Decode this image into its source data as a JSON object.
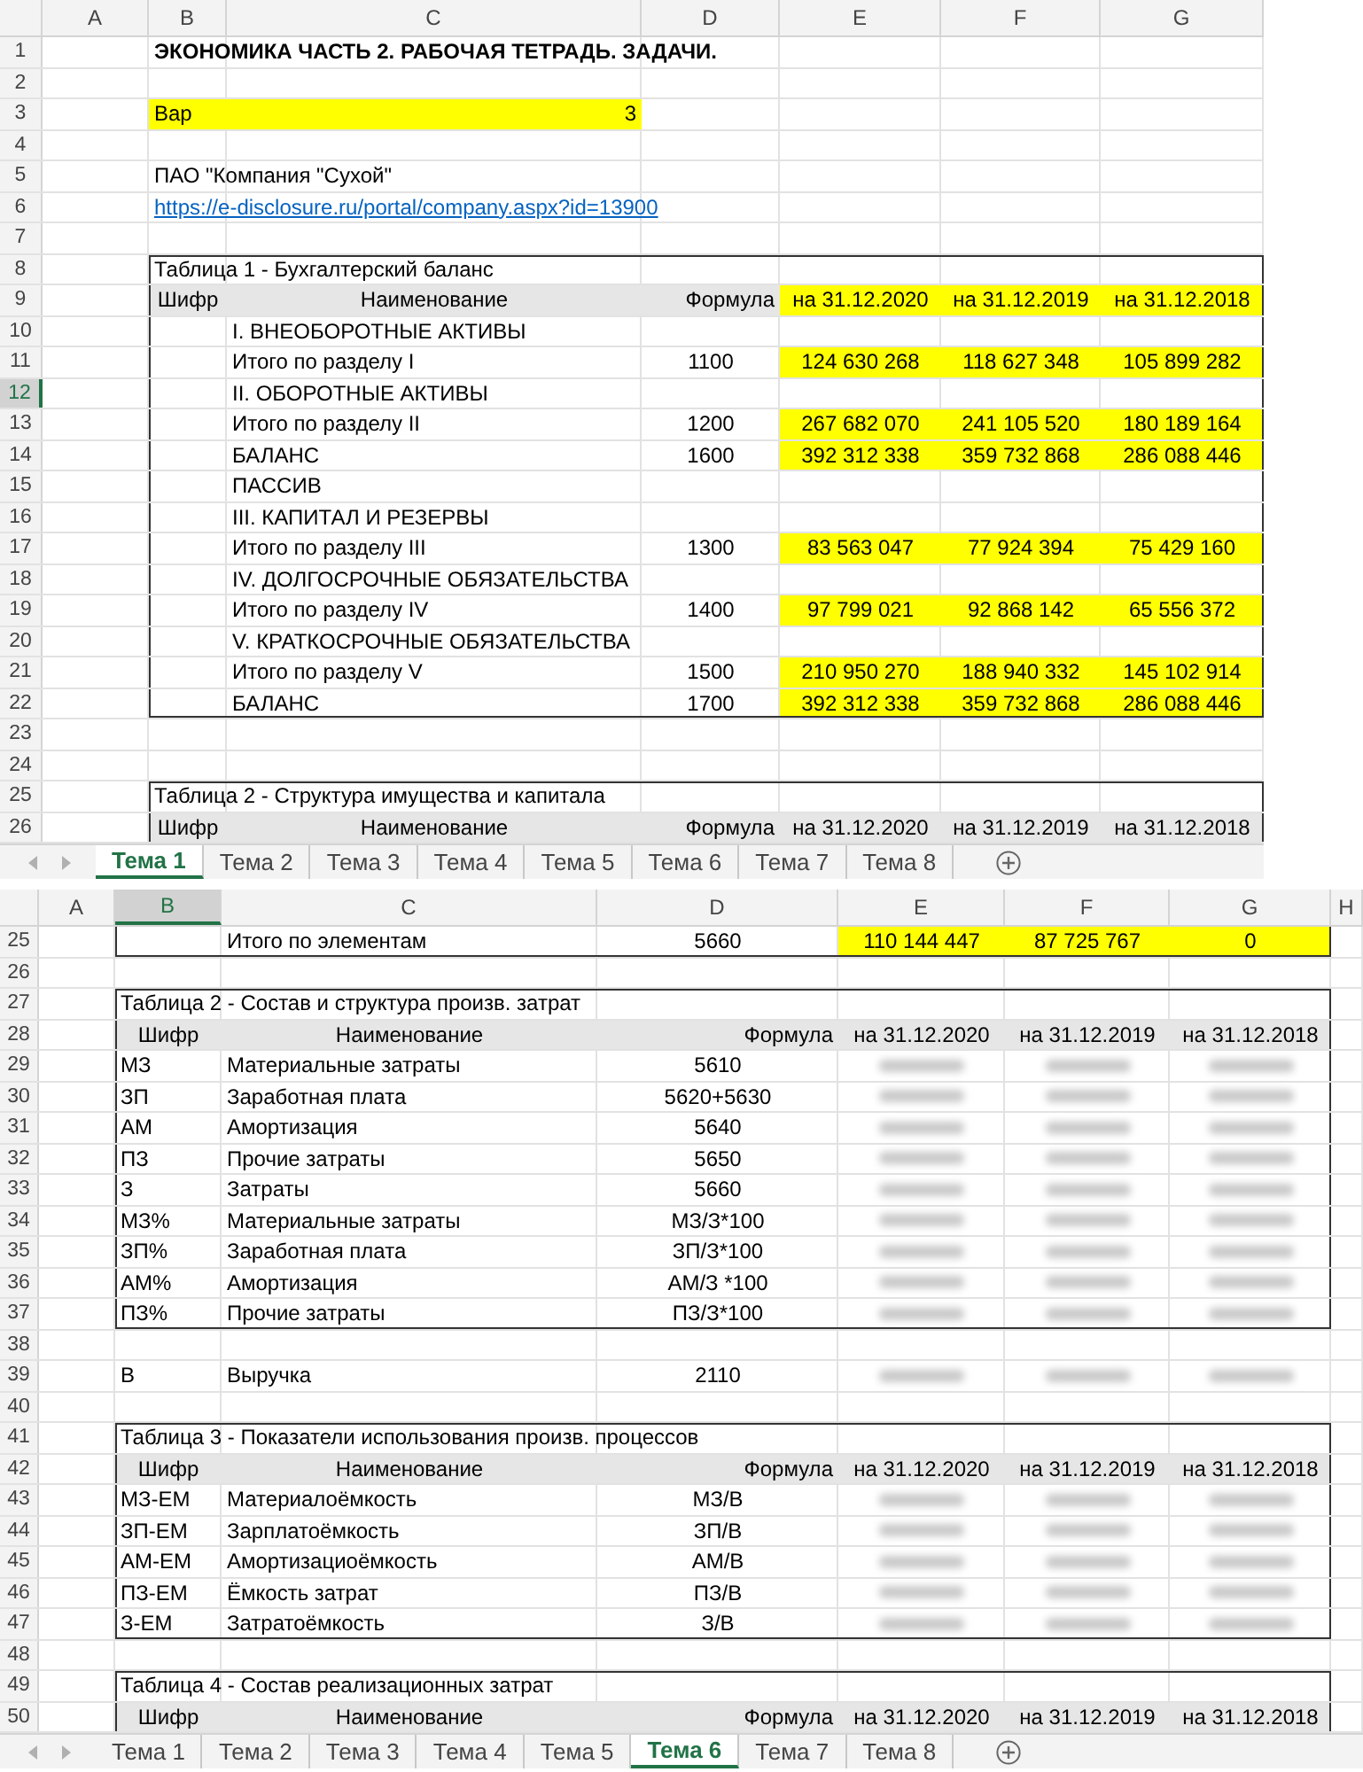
{
  "sheets": [
    {
      "columns": [
        {
          "label": "A",
          "selected": false
        },
        {
          "label": "B",
          "selected": false
        },
        {
          "label": "C",
          "selected": false
        },
        {
          "label": "D",
          "selected": false
        },
        {
          "label": "E",
          "selected": false
        },
        {
          "label": "F",
          "selected": false
        },
        {
          "label": "G",
          "selected": false
        }
      ],
      "rows": [
        {
          "num": "1",
          "selected": false,
          "kind": "title",
          "text": "ЭКОНОМИКА ЧАСТЬ 2. РАБОЧАЯ ТЕТРАДЬ. ЗАДАЧИ."
        },
        {
          "num": "2",
          "selected": false,
          "kind": "blank"
        },
        {
          "num": "3",
          "selected": false,
          "kind": "var",
          "label": "Вар",
          "value": "3"
        },
        {
          "num": "4",
          "selected": false,
          "kind": "blank"
        },
        {
          "num": "5",
          "selected": false,
          "kind": "text",
          "text": "ПАО \"Компания \"Сухой\""
        },
        {
          "num": "6",
          "selected": false,
          "kind": "link",
          "text": "https://e-disclosure.ru/portal/company.aspx?id=13900"
        },
        {
          "num": "7",
          "selected": false,
          "kind": "blank"
        },
        {
          "num": "8",
          "selected": false,
          "kind": "caption",
          "text": "Таблица 1 - Бухгалтерский баланс",
          "boxed": true
        },
        {
          "num": "9",
          "selected": false,
          "kind": "header",
          "code": "Шифр",
          "name": "Наименование",
          "formula": "Формула",
          "dates": [
            "на 31.12.2020",
            "на 31.12.2019",
            "на 31.12.2018"
          ],
          "highlighted": true,
          "boxed": true
        },
        {
          "num": "10",
          "selected": false,
          "kind": "section",
          "text": "I. ВНЕОБОРОТНЫЕ АКТИВЫ",
          "boxed": true
        },
        {
          "num": "11",
          "selected": false,
          "kind": "data",
          "name": "Итого по разделу I",
          "formula": "1100",
          "values": [
            "124 630 268",
            "118 627 348",
            "105 899 282"
          ],
          "highlighted": true,
          "values_hidden": false,
          "boxed": true
        },
        {
          "num": "12",
          "selected": true,
          "kind": "section",
          "text": "II. ОБОРОТНЫЕ АКТИВЫ",
          "boxed": true
        },
        {
          "num": "13",
          "selected": false,
          "kind": "data",
          "name": "Итого по разделу II",
          "formula": "1200",
          "values": [
            "267 682 070",
            "241 105 520",
            "180 189 164"
          ],
          "highlighted": true,
          "values_hidden": false,
          "boxed": true
        },
        {
          "num": "14",
          "selected": false,
          "kind": "data",
          "name": "БАЛАНС",
          "formula": "1600",
          "values": [
            "392 312 338",
            "359 732 868",
            "286 088 446"
          ],
          "highlighted": true,
          "values_hidden": false,
          "boxed": true
        },
        {
          "num": "15",
          "selected": false,
          "kind": "section",
          "text": "ПАССИВ",
          "boxed": true
        },
        {
          "num": "16",
          "selected": false,
          "kind": "section",
          "text": "III. КАПИТАЛ И РЕЗЕРВЫ",
          "boxed": true
        },
        {
          "num": "17",
          "selected": false,
          "kind": "data",
          "name": "Итого по разделу III",
          "formula": "1300",
          "values": [
            "83 563 047",
            "77 924 394",
            "75 429 160"
          ],
          "highlighted": true,
          "values_hidden": false,
          "boxed": true
        },
        {
          "num": "18",
          "selected": false,
          "kind": "section",
          "text": "IV. ДОЛГОСРОЧНЫЕ ОБЯЗАТЕЛЬСТВА",
          "boxed": true
        },
        {
          "num": "19",
          "selected": false,
          "kind": "data",
          "name": "Итого по разделу IV",
          "formula": "1400",
          "values": [
            "97 799 021",
            "92 868 142",
            "65 556 372"
          ],
          "highlighted": true,
          "values_hidden": false,
          "boxed": true
        },
        {
          "num": "20",
          "selected": false,
          "kind": "section",
          "text": "V. КРАТКОСРОЧНЫЕ ОБЯЗАТЕЛЬСТВА",
          "boxed": true
        },
        {
          "num": "21",
          "selected": false,
          "kind": "data",
          "name": "Итого по разделу V",
          "formula": "1500",
          "values": [
            "210 950 270",
            "188 940 332",
            "145 102 914"
          ],
          "highlighted": true,
          "values_hidden": false,
          "boxed": true
        },
        {
          "num": "22",
          "selected": false,
          "kind": "data",
          "name": "БАЛАНС",
          "formula": "1700",
          "values": [
            "392 312 338",
            "359 732 868",
            "286 088 446"
          ],
          "highlighted": true,
          "values_hidden": false,
          "boxed": true,
          "box_end": true
        },
        {
          "num": "23",
          "selected": false,
          "kind": "blank"
        },
        {
          "num": "24",
          "selected": false,
          "kind": "blank"
        },
        {
          "num": "25",
          "selected": false,
          "kind": "caption",
          "text": "Таблица 2 - Структура имущества и капитала",
          "boxed": true
        },
        {
          "num": "26",
          "selected": false,
          "kind": "header",
          "code": "Шифр",
          "name": "Наименование",
          "formula": "Формула",
          "dates": [
            "на 31.12.2020",
            "на 31.12.2019",
            "на 31.12.2018"
          ],
          "highlighted": false,
          "boxed": true
        }
      ],
      "tabs": [
        {
          "label": "Тема 1",
          "selected": true
        },
        {
          "label": "Тема 2",
          "selected": false
        },
        {
          "label": "Тема 3",
          "selected": false
        },
        {
          "label": "Тема 4",
          "selected": false
        },
        {
          "label": "Тема 5",
          "selected": false
        },
        {
          "label": "Тема 6",
          "selected": false
        },
        {
          "label": "Тема 7",
          "selected": false
        },
        {
          "label": "Тема 8",
          "selected": false
        }
      ]
    },
    {
      "columns": [
        {
          "label": "A",
          "selected": false
        },
        {
          "label": "B",
          "selected": true
        },
        {
          "label": "C",
          "selected": false
        },
        {
          "label": "D",
          "selected": false
        },
        {
          "label": "E",
          "selected": false
        },
        {
          "label": "F",
          "selected": false
        },
        {
          "label": "G",
          "selected": false
        },
        {
          "label": "H",
          "selected": false
        }
      ],
      "rows": [
        {
          "num": "25",
          "selected": false,
          "kind": "data",
          "name": "Итого по элементам",
          "formula": "5660",
          "values": [
            "110 144 447",
            "87 725 767",
            "0"
          ],
          "highlighted": true,
          "values_hidden": false,
          "boxed": true,
          "box_end": true
        },
        {
          "num": "26",
          "selected": false,
          "kind": "blank"
        },
        {
          "num": "27",
          "selected": false,
          "kind": "caption",
          "text": "Таблица 2 - Состав и структура произв. затрат",
          "boxed": true
        },
        {
          "num": "28",
          "selected": false,
          "kind": "header",
          "code": "Шифр",
          "name": "Наименование",
          "formula": "Формула",
          "dates": [
            "на 31.12.2020",
            "на 31.12.2019",
            "на 31.12.2018"
          ],
          "highlighted": false,
          "boxed": true
        },
        {
          "num": "29",
          "selected": false,
          "kind": "data",
          "code": "МЗ",
          "name": "Материальные затраты",
          "formula": "5610",
          "values_hidden": true,
          "boxed": true
        },
        {
          "num": "30",
          "selected": false,
          "kind": "data",
          "code": "ЗП",
          "name": "Заработная плата",
          "formula": "5620+5630",
          "values_hidden": true,
          "boxed": true
        },
        {
          "num": "31",
          "selected": false,
          "kind": "data",
          "code": "АМ",
          "name": "Амортизация",
          "formula": "5640",
          "values_hidden": true,
          "boxed": true
        },
        {
          "num": "32",
          "selected": false,
          "kind": "data",
          "code": "ПЗ",
          "name": "Прочие затраты",
          "formula": "5650",
          "values_hidden": true,
          "boxed": true
        },
        {
          "num": "33",
          "selected": false,
          "kind": "data",
          "code": "З",
          "name": "Затраты",
          "formula": "5660",
          "values_hidden": true,
          "boxed": true
        },
        {
          "num": "34",
          "selected": false,
          "kind": "data",
          "code": "МЗ%",
          "name": "Материальные затраты",
          "formula": "МЗ/З*100",
          "values_hidden": true,
          "boxed": true
        },
        {
          "num": "35",
          "selected": false,
          "kind": "data",
          "code": "ЗП%",
          "name": "Заработная плата",
          "formula": "ЗП/З*100",
          "values_hidden": true,
          "boxed": true
        },
        {
          "num": "36",
          "selected": false,
          "kind": "data",
          "code": "АМ%",
          "name": "Амортизация",
          "formula": "АМ/З *100",
          "values_hidden": true,
          "boxed": true
        },
        {
          "num": "37",
          "selected": false,
          "kind": "data",
          "code": "ПЗ%",
          "name": "Прочие затраты",
          "formula": "ПЗ/З*100",
          "values_hidden": true,
          "boxed": true,
          "box_end": true
        },
        {
          "num": "38",
          "selected": false,
          "kind": "blank"
        },
        {
          "num": "39",
          "selected": false,
          "kind": "data",
          "code": "В",
          "name": "Выручка",
          "formula": "2110",
          "values_hidden": true
        },
        {
          "num": "40",
          "selected": false,
          "kind": "blank"
        },
        {
          "num": "41",
          "selected": false,
          "kind": "caption",
          "text": "Таблица 3 - Показатели использования произв. процессов",
          "boxed": true
        },
        {
          "num": "42",
          "selected": false,
          "kind": "header",
          "code": "Шифр",
          "name": "Наименование",
          "formula": "Формула",
          "dates": [
            "на 31.12.2020",
            "на 31.12.2019",
            "на 31.12.2018"
          ],
          "highlighted": false,
          "boxed": true
        },
        {
          "num": "43",
          "selected": false,
          "kind": "data",
          "code": "МЗ-ЕМ",
          "name": "Материалоёмкость",
          "formula": "МЗ/В",
          "values_hidden": true,
          "boxed": true
        },
        {
          "num": "44",
          "selected": false,
          "kind": "data",
          "code": "ЗП-ЕМ",
          "name": "Зарплатоёмкость",
          "formula": "ЗП/В",
          "values_hidden": true,
          "boxed": true
        },
        {
          "num": "45",
          "selected": false,
          "kind": "data",
          "code": "АМ-ЕМ",
          "name": "Амортизациоёмкость",
          "formula": "АМ/В",
          "values_hidden": true,
          "boxed": true
        },
        {
          "num": "46",
          "selected": false,
          "kind": "data",
          "code": "ПЗ-ЕМ",
          "name": "Ёмкость затрат",
          "formula": "ПЗ/В",
          "values_hidden": true,
          "boxed": true
        },
        {
          "num": "47",
          "selected": false,
          "kind": "data",
          "code": "З-ЕМ",
          "name": "Затратоёмкость",
          "formula": "З/В",
          "values_hidden": true,
          "boxed": true,
          "box_end": true
        },
        {
          "num": "48",
          "selected": false,
          "kind": "blank"
        },
        {
          "num": "49",
          "selected": false,
          "kind": "caption",
          "text": "Таблица 4 - Состав реализационных затрат",
          "boxed": true
        },
        {
          "num": "50",
          "selected": false,
          "kind": "header",
          "code": "Шифр",
          "name": "Наименование",
          "formula": "Формула",
          "dates": [
            "на 31.12.2020",
            "на 31.12.2019",
            "на 31.12.2018"
          ],
          "highlighted": false,
          "boxed": true
        }
      ],
      "tabs": [
        {
          "label": "Тема 1",
          "selected": false
        },
        {
          "label": "Тема 2",
          "selected": false
        },
        {
          "label": "Тема 3",
          "selected": false
        },
        {
          "label": "Тема 4",
          "selected": false
        },
        {
          "label": "Тема 5",
          "selected": false
        },
        {
          "label": "Тема 6",
          "selected": true
        },
        {
          "label": "Тема 7",
          "selected": false
        },
        {
          "label": "Тема 8",
          "selected": false
        }
      ]
    }
  ]
}
